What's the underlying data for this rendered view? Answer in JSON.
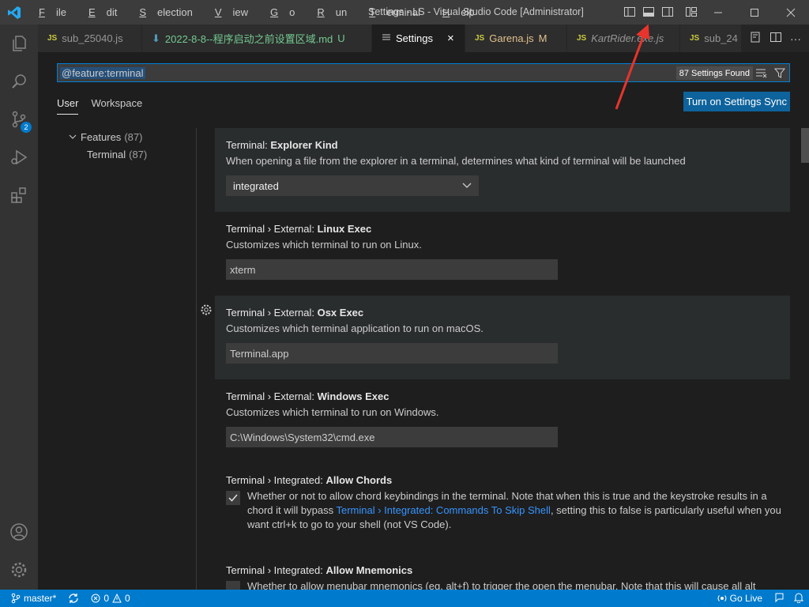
{
  "window": {
    "title": "Settings - LS - Visual Studio Code [Administrator]",
    "menu": [
      {
        "first": "F",
        "rest": "ile"
      },
      {
        "first": "E",
        "rest": "dit"
      },
      {
        "first": "S",
        "rest": "election"
      },
      {
        "first": "V",
        "rest": "iew"
      },
      {
        "first": "G",
        "rest": "o"
      },
      {
        "first": "R",
        "rest": "un"
      },
      {
        "first": "T",
        "rest": "erminal"
      },
      {
        "first": "H",
        "rest": "elp"
      }
    ]
  },
  "tabs": [
    {
      "icon": "JS",
      "label": "sub_25040.js"
    },
    {
      "icon": "download-icon",
      "label": "2022-8-8--程序启动之前设置区域.md",
      "status": "U"
    },
    {
      "icon": "settings-lines-icon",
      "label": "Settings",
      "close": "×"
    },
    {
      "icon": "JS",
      "label": "Garena.js",
      "status": "M"
    },
    {
      "icon": "JS",
      "label": "KartRider.exe.js"
    },
    {
      "icon": "JS",
      "label": "sub_24"
    }
  ],
  "activity_badge": "2",
  "search": {
    "query": "@feature:terminal",
    "found": "87 Settings Found"
  },
  "scopes": {
    "user": "User",
    "workspace": "Workspace"
  },
  "sync_button": "Turn on Settings Sync",
  "toc": {
    "features": "Features",
    "features_count": "(87)",
    "terminal": "Terminal",
    "terminal_count": "(87)"
  },
  "settings": {
    "explorer_kind": {
      "category": "Terminal: ",
      "name": "Explorer Kind",
      "description": "When opening a file from the explorer in a terminal, determines what kind of terminal will be launched",
      "value": "integrated"
    },
    "linux_exec": {
      "category": "Terminal › External: ",
      "name": "Linux Exec",
      "description": "Customizes which terminal to run on Linux.",
      "value": "xterm"
    },
    "osx_exec": {
      "category": "Terminal › External: ",
      "name": "Osx Exec",
      "description": "Customizes which terminal application to run on macOS.",
      "value": "Terminal.app"
    },
    "windows_exec": {
      "category": "Terminal › External: ",
      "name": "Windows Exec",
      "description": "Customizes which terminal to run on Windows.",
      "value": "C:\\Windows\\System32\\cmd.exe"
    },
    "allow_chords": {
      "category": "Terminal › Integrated: ",
      "name": "Allow Chords",
      "desc_line1": "Whether or not to allow chord keybindings in the terminal. Note that when this is true and the keystroke results in a",
      "desc_line2_pre": "chord it will bypass ",
      "desc_link": "Terminal › Integrated: Commands To Skip Shell",
      "desc_line2_post": ", setting this to false is particularly useful when you",
      "desc_line3": "want ctrl+k to go to your shell (not VS Code).",
      "checked": true
    },
    "allow_mnemonics": {
      "category": "Terminal › Integrated: ",
      "name": "Allow Mnemonics",
      "description": "Whether to allow menubar mnemonics (eg. alt+f) to trigger the open the menubar. Note that this will cause all alt",
      "checked": false
    }
  },
  "statusbar": {
    "branch": "master*",
    "errors": "0",
    "warnings": "0",
    "golive": "Go Live"
  },
  "colors": {
    "accent": "#007acc",
    "button": "#0e639c",
    "annotation_arrow": "#e8342c"
  }
}
